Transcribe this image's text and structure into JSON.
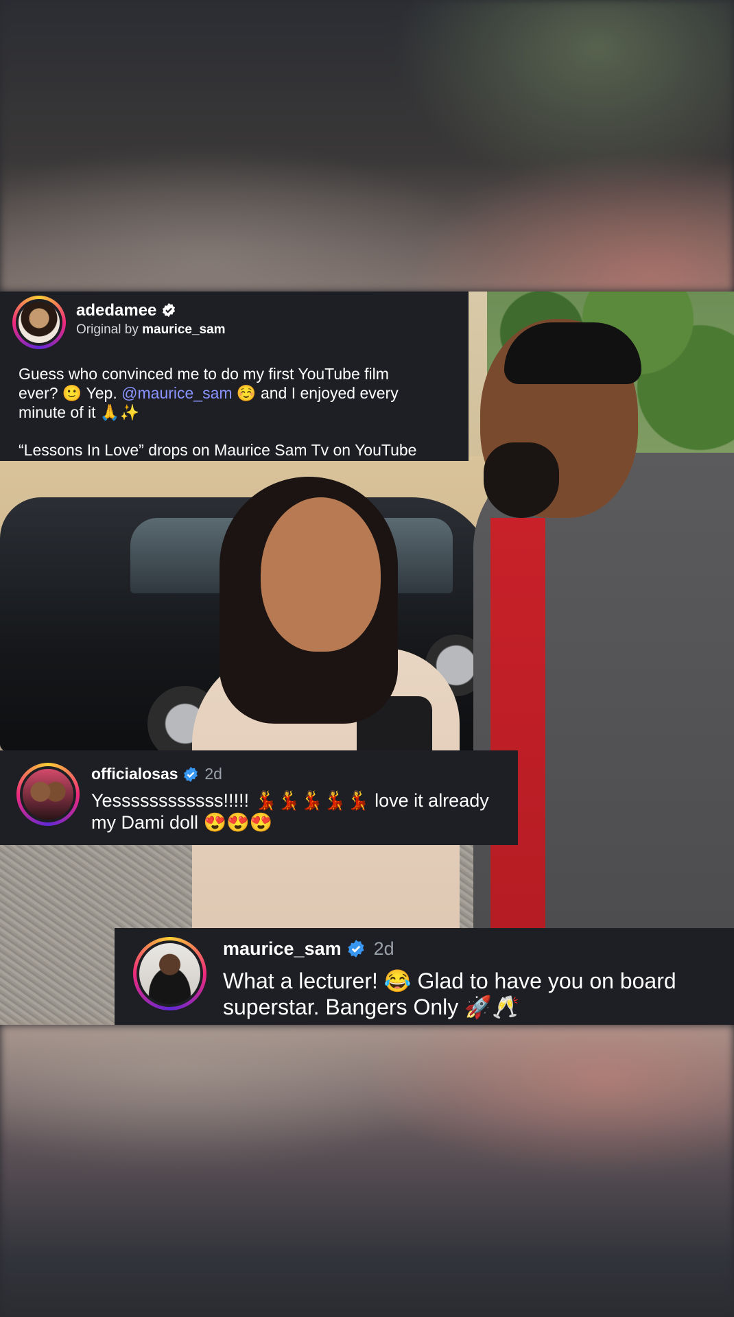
{
  "post": {
    "username": "adedamee",
    "original_prefix": "Original by ",
    "original_author": "maurice_sam",
    "caption_line1": "Guess who convinced me to do my first YouTube film",
    "caption_line2a": "ever? 🙂 Yep. ",
    "caption_mention": "@maurice_sam",
    "caption_line2b": " ☺️ and I enjoyed every",
    "caption_line3": "minute of it 🙏✨",
    "caption_line4": "“Lessons In Love” drops on Maurice Sam Tv on YouTube"
  },
  "comments": [
    {
      "username": "officialosas",
      "time": "2d",
      "line1": "Yessssssssssss!!!!! 💃💃💃💃💃 love it already",
      "line2": "my Dami doll 😍😍😍"
    },
    {
      "username": "maurice_sam",
      "time": "2d",
      "line1": "What a lecturer! 😂 Glad to have you on board",
      "line2": "superstar. Bangers Only 🚀🥂"
    }
  ],
  "colors": {
    "card_bg": "#1e1f24",
    "verified_white": "#ffffff",
    "verified_blue": "#3897f0",
    "mention": "#8a94ff",
    "meta": "#9aa0a8"
  },
  "icons": {
    "post_verified": "verified-badge-icon",
    "comment_verified": "verified-badge-icon"
  }
}
